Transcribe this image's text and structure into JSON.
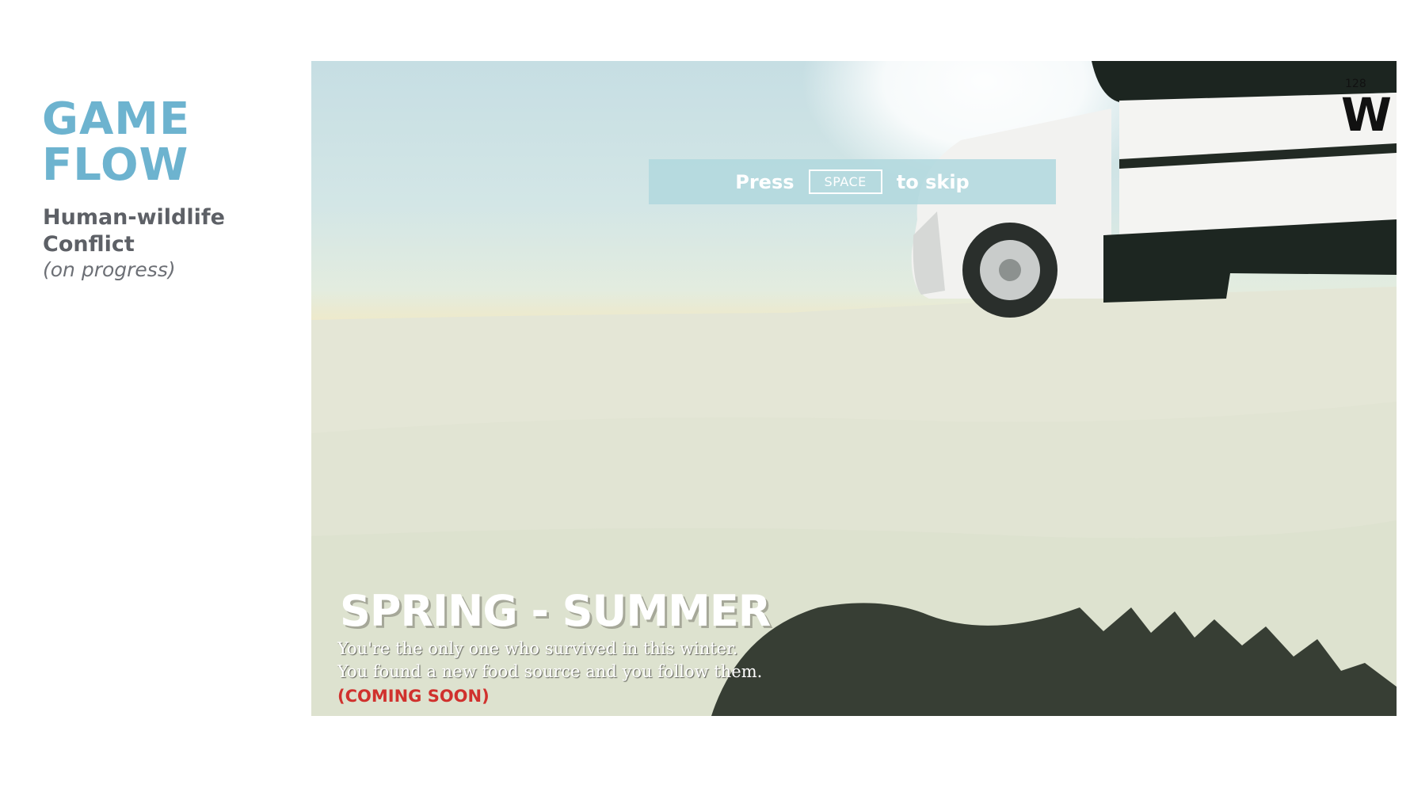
{
  "slide": {
    "title_line1": "GAME",
    "title_line2": "FLOW",
    "subtitle": "Human-wildlife Conflict",
    "note": "(on progress)"
  },
  "game": {
    "skip_prompt": {
      "press": "Press",
      "key": "SPACE",
      "action": "to skip"
    },
    "truck_sign": {
      "number": "128",
      "letter": "W"
    },
    "season_title": "SPRING - SUMMER",
    "story_line1": "You're the only one who survived in this winter.",
    "story_line2": "You found a new food source and you follow them.",
    "status": "(COMING SOON)"
  },
  "colors": {
    "title_accent": "#6db3cf",
    "subtitle_text": "#5d6066",
    "coming_soon": "#d0312d",
    "banner": "#b2d8de",
    "snow": "#e6e6d8"
  }
}
